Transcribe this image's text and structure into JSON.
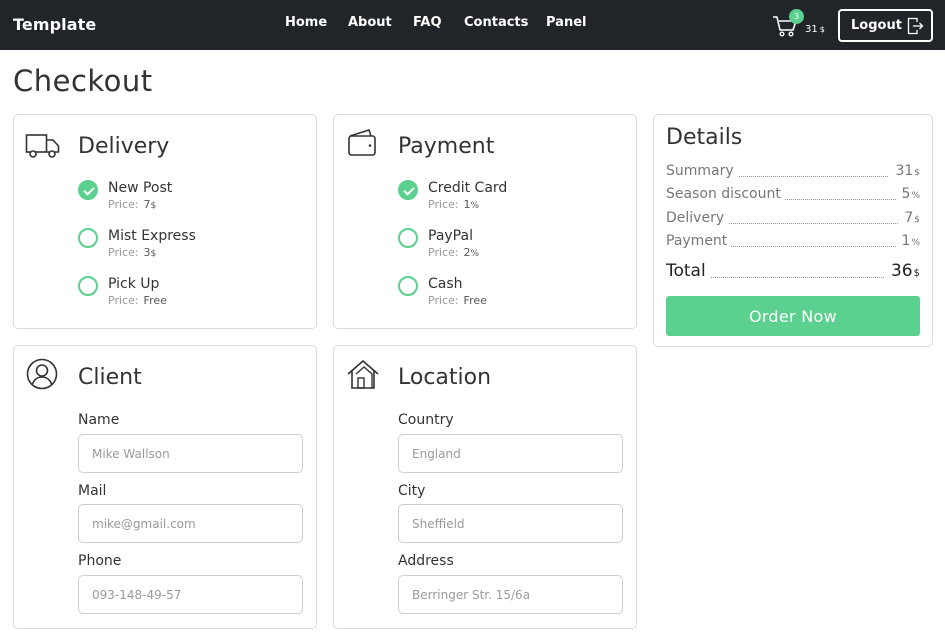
{
  "brand": "Template",
  "nav": {
    "links": [
      "Home",
      "About",
      "FAQ",
      "Contacts",
      "Panel"
    ],
    "cart_count": "3",
    "cart_total": "31",
    "currency": "$",
    "logout_label": "Logout"
  },
  "page_title": "Checkout",
  "delivery": {
    "title": "Delivery",
    "options": [
      {
        "label": "New Post",
        "price_label": "Price:",
        "price": "7",
        "unit": "$",
        "selected": true
      },
      {
        "label": "Mist Express",
        "price_label": "Price:",
        "price": "3",
        "unit": "$",
        "selected": false
      },
      {
        "label": "Pick Up",
        "price_label": "Price:",
        "price": "Free",
        "unit": "",
        "selected": false
      }
    ]
  },
  "payment": {
    "title": "Payment",
    "options": [
      {
        "label": "Credit Card",
        "price_label": "Price:",
        "price": "1",
        "unit": "%",
        "selected": true
      },
      {
        "label": "PayPal",
        "price_label": "Price:",
        "price": "2",
        "unit": "%",
        "selected": false
      },
      {
        "label": "Cash",
        "price_label": "Price:",
        "price": "Free",
        "unit": "",
        "selected": false
      }
    ]
  },
  "client": {
    "title": "Client",
    "fields": [
      {
        "label": "Name",
        "placeholder": "Mike Wallson"
      },
      {
        "label": "Mail",
        "placeholder": "mike@gmail.com"
      },
      {
        "label": "Phone",
        "placeholder": "093-148-49-57"
      }
    ]
  },
  "location": {
    "title": "Location",
    "fields": [
      {
        "label": "Country",
        "placeholder": "England"
      },
      {
        "label": "City",
        "placeholder": "Sheffield"
      },
      {
        "label": "Address",
        "placeholder": "Berringer Str. 15/6a"
      }
    ]
  },
  "details": {
    "title": "Details",
    "rows": [
      {
        "label": "Summary",
        "value": "31",
        "unit": "$"
      },
      {
        "label": "Season discount",
        "value": "5",
        "unit": "%"
      },
      {
        "label": "Delivery",
        "value": "7",
        "unit": "$"
      },
      {
        "label": "Payment",
        "value": "1",
        "unit": "%"
      }
    ],
    "total": {
      "label": "Total",
      "value": "36",
      "unit": "$"
    },
    "order_button": "Order Now"
  },
  "colors": {
    "accent": "#5bd08f",
    "navbar": "#212529"
  },
  "icons": {
    "cart": "cart-icon",
    "logout": "logout-icon",
    "delivery": "truck-icon",
    "payment": "wallet-icon",
    "client": "user-icon",
    "location": "house-icon"
  }
}
